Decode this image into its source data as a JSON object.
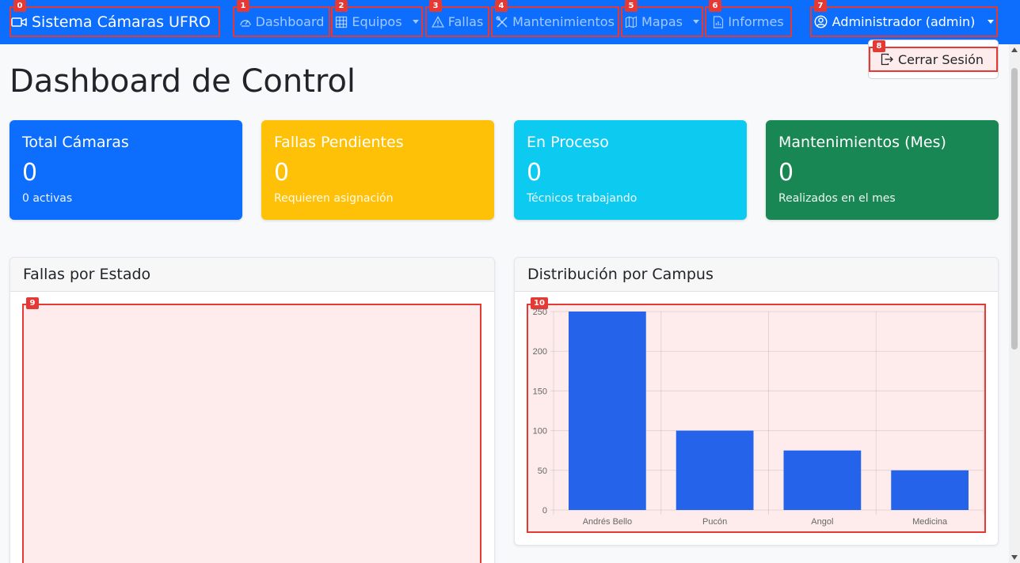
{
  "navbar": {
    "brand": "Sistema Cámaras UFRO",
    "links": {
      "dashboard": "Dashboard",
      "equipos": "Equipos",
      "fallas": "Fallas",
      "mantenimientos": "Mantenimientos",
      "mapas": "Mapas",
      "informes": "Informes"
    },
    "user": "Administrador (admin)",
    "logout": "Cerrar Sesión"
  },
  "markers": [
    "0",
    "1",
    "2",
    "3",
    "4",
    "5",
    "6",
    "7",
    "8",
    "9",
    "10"
  ],
  "page_title": "Dashboard de Control",
  "cards": [
    {
      "title": "Total Cámaras",
      "value": "0",
      "sub": "0 activas",
      "color": "#0d6efd"
    },
    {
      "title": "Fallas Pendientes",
      "value": "0",
      "sub": "Requieren asignación",
      "color": "#ffc107"
    },
    {
      "title": "En Proceso",
      "value": "0",
      "sub": "Técnicos trabajando",
      "color": "#0dcaf0"
    },
    {
      "title": "Mantenimientos (Mes)",
      "value": "0",
      "sub": "Realizados en el mes",
      "color": "#198754"
    }
  ],
  "panels": {
    "fallas_estado": "Fallas por Estado",
    "distribucion": "Distribución por Campus"
  },
  "chart_data": [
    {
      "type": "bar",
      "categories": [
        "Andrés Bello",
        "Pucón",
        "Angol",
        "Medicina"
      ],
      "values": [
        250,
        100,
        75,
        50
      ],
      "ylim": [
        0,
        250
      ],
      "yticks": [
        0,
        50,
        100,
        150,
        200,
        250
      ],
      "bar_color": "#2563eb",
      "grid": true
    }
  ]
}
